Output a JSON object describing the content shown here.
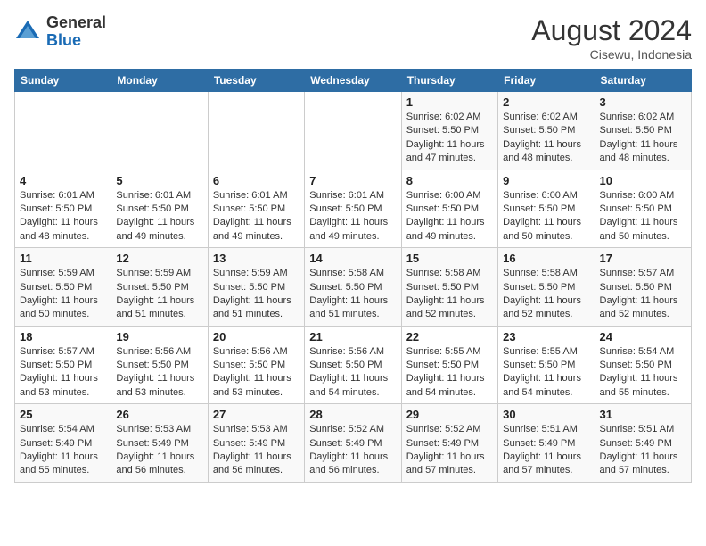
{
  "header": {
    "logo": {
      "general": "General",
      "blue": "Blue"
    },
    "month_year": "August 2024",
    "location": "Cisewu, Indonesia"
  },
  "days_of_week": [
    "Sunday",
    "Monday",
    "Tuesday",
    "Wednesday",
    "Thursday",
    "Friday",
    "Saturday"
  ],
  "weeks": [
    [
      {
        "day": "",
        "info": ""
      },
      {
        "day": "",
        "info": ""
      },
      {
        "day": "",
        "info": ""
      },
      {
        "day": "",
        "info": ""
      },
      {
        "day": "1",
        "info": "Sunrise: 6:02 AM\nSunset: 5:50 PM\nDaylight: 11 hours and 47 minutes."
      },
      {
        "day": "2",
        "info": "Sunrise: 6:02 AM\nSunset: 5:50 PM\nDaylight: 11 hours and 48 minutes."
      },
      {
        "day": "3",
        "info": "Sunrise: 6:02 AM\nSunset: 5:50 PM\nDaylight: 11 hours and 48 minutes."
      }
    ],
    [
      {
        "day": "4",
        "info": "Sunrise: 6:01 AM\nSunset: 5:50 PM\nDaylight: 11 hours and 48 minutes."
      },
      {
        "day": "5",
        "info": "Sunrise: 6:01 AM\nSunset: 5:50 PM\nDaylight: 11 hours and 49 minutes."
      },
      {
        "day": "6",
        "info": "Sunrise: 6:01 AM\nSunset: 5:50 PM\nDaylight: 11 hours and 49 minutes."
      },
      {
        "day": "7",
        "info": "Sunrise: 6:01 AM\nSunset: 5:50 PM\nDaylight: 11 hours and 49 minutes."
      },
      {
        "day": "8",
        "info": "Sunrise: 6:00 AM\nSunset: 5:50 PM\nDaylight: 11 hours and 49 minutes."
      },
      {
        "day": "9",
        "info": "Sunrise: 6:00 AM\nSunset: 5:50 PM\nDaylight: 11 hours and 50 minutes."
      },
      {
        "day": "10",
        "info": "Sunrise: 6:00 AM\nSunset: 5:50 PM\nDaylight: 11 hours and 50 minutes."
      }
    ],
    [
      {
        "day": "11",
        "info": "Sunrise: 5:59 AM\nSunset: 5:50 PM\nDaylight: 11 hours and 50 minutes."
      },
      {
        "day": "12",
        "info": "Sunrise: 5:59 AM\nSunset: 5:50 PM\nDaylight: 11 hours and 51 minutes."
      },
      {
        "day": "13",
        "info": "Sunrise: 5:59 AM\nSunset: 5:50 PM\nDaylight: 11 hours and 51 minutes."
      },
      {
        "day": "14",
        "info": "Sunrise: 5:58 AM\nSunset: 5:50 PM\nDaylight: 11 hours and 51 minutes."
      },
      {
        "day": "15",
        "info": "Sunrise: 5:58 AM\nSunset: 5:50 PM\nDaylight: 11 hours and 52 minutes."
      },
      {
        "day": "16",
        "info": "Sunrise: 5:58 AM\nSunset: 5:50 PM\nDaylight: 11 hours and 52 minutes."
      },
      {
        "day": "17",
        "info": "Sunrise: 5:57 AM\nSunset: 5:50 PM\nDaylight: 11 hours and 52 minutes."
      }
    ],
    [
      {
        "day": "18",
        "info": "Sunrise: 5:57 AM\nSunset: 5:50 PM\nDaylight: 11 hours and 53 minutes."
      },
      {
        "day": "19",
        "info": "Sunrise: 5:56 AM\nSunset: 5:50 PM\nDaylight: 11 hours and 53 minutes."
      },
      {
        "day": "20",
        "info": "Sunrise: 5:56 AM\nSunset: 5:50 PM\nDaylight: 11 hours and 53 minutes."
      },
      {
        "day": "21",
        "info": "Sunrise: 5:56 AM\nSunset: 5:50 PM\nDaylight: 11 hours and 54 minutes."
      },
      {
        "day": "22",
        "info": "Sunrise: 5:55 AM\nSunset: 5:50 PM\nDaylight: 11 hours and 54 minutes."
      },
      {
        "day": "23",
        "info": "Sunrise: 5:55 AM\nSunset: 5:50 PM\nDaylight: 11 hours and 54 minutes."
      },
      {
        "day": "24",
        "info": "Sunrise: 5:54 AM\nSunset: 5:50 PM\nDaylight: 11 hours and 55 minutes."
      }
    ],
    [
      {
        "day": "25",
        "info": "Sunrise: 5:54 AM\nSunset: 5:49 PM\nDaylight: 11 hours and 55 minutes."
      },
      {
        "day": "26",
        "info": "Sunrise: 5:53 AM\nSunset: 5:49 PM\nDaylight: 11 hours and 56 minutes."
      },
      {
        "day": "27",
        "info": "Sunrise: 5:53 AM\nSunset: 5:49 PM\nDaylight: 11 hours and 56 minutes."
      },
      {
        "day": "28",
        "info": "Sunrise: 5:52 AM\nSunset: 5:49 PM\nDaylight: 11 hours and 56 minutes."
      },
      {
        "day": "29",
        "info": "Sunrise: 5:52 AM\nSunset: 5:49 PM\nDaylight: 11 hours and 57 minutes."
      },
      {
        "day": "30",
        "info": "Sunrise: 5:51 AM\nSunset: 5:49 PM\nDaylight: 11 hours and 57 minutes."
      },
      {
        "day": "31",
        "info": "Sunrise: 5:51 AM\nSunset: 5:49 PM\nDaylight: 11 hours and 57 minutes."
      }
    ]
  ]
}
